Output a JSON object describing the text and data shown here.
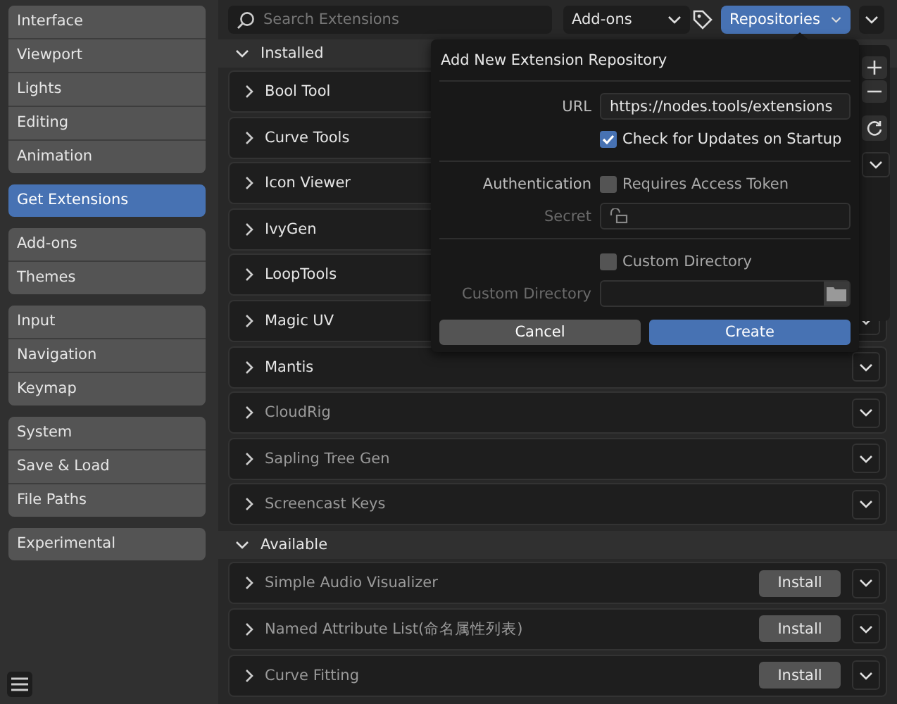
{
  "sidebar": {
    "groups": [
      [
        {
          "label": "Interface",
          "selected": false
        },
        {
          "label": "Viewport",
          "selected": false
        },
        {
          "label": "Lights",
          "selected": false
        },
        {
          "label": "Editing",
          "selected": false
        },
        {
          "label": "Animation",
          "selected": false
        }
      ],
      [
        {
          "label": "Get Extensions",
          "selected": true
        }
      ],
      [
        {
          "label": "Add-ons",
          "selected": false
        },
        {
          "label": "Themes",
          "selected": false
        }
      ],
      [
        {
          "label": "Input",
          "selected": false
        },
        {
          "label": "Navigation",
          "selected": false
        },
        {
          "label": "Keymap",
          "selected": false
        }
      ],
      [
        {
          "label": "System",
          "selected": false
        },
        {
          "label": "Save & Load",
          "selected": false
        },
        {
          "label": "File Paths",
          "selected": false
        }
      ],
      [
        {
          "label": "Experimental",
          "selected": false
        }
      ]
    ]
  },
  "toolbar": {
    "search": {
      "placeholder": "Search Extensions"
    },
    "filter": "Add-ons",
    "repositories": "Repositories"
  },
  "sections": [
    {
      "title": "Installed",
      "expanded": true,
      "items": [
        {
          "name": "Bool Tool",
          "enabled": true
        },
        {
          "name": "Curve Tools",
          "enabled": true
        },
        {
          "name": "Icon Viewer",
          "enabled": true
        },
        {
          "name": "IvyGen",
          "enabled": true
        },
        {
          "name": "LoopTools",
          "enabled": true
        },
        {
          "name": "Magic UV",
          "enabled": true,
          "dropdown": true
        },
        {
          "name": "Mantis",
          "enabled": true,
          "dropdown": true
        },
        {
          "name": "CloudRig",
          "enabled": false,
          "dropdown": true
        },
        {
          "name": "Sapling Tree Gen",
          "enabled": false,
          "dropdown": true
        },
        {
          "name": "Screencast Keys",
          "enabled": false,
          "dropdown": true
        }
      ]
    },
    {
      "title": "Available",
      "expanded": true,
      "items": [
        {
          "name": "Simple Audio Visualizer",
          "enabled": false,
          "install": "Install",
          "dropdown": true
        },
        {
          "name": "Named Attribute List(命名属性列表)",
          "enabled": false,
          "install": "Install",
          "dropdown": true
        },
        {
          "name": "Curve Fitting",
          "enabled": false,
          "install": "Install",
          "dropdown": true
        }
      ]
    }
  ],
  "dialog": {
    "title": "Add New Extension Repository",
    "fields": [
      {
        "kind": "text",
        "label": "URL",
        "value": "https://nodes.tools/extensions",
        "disabled": false
      },
      {
        "kind": "check",
        "label": "Check for Updates on Startup",
        "checked": true
      },
      {
        "kind": "separator"
      },
      {
        "kind": "check",
        "label": "Requires Access Token",
        "caption": "Authentication",
        "checked": false
      },
      {
        "kind": "secret",
        "label": "Secret",
        "disabled": true
      },
      {
        "kind": "separator"
      },
      {
        "kind": "check",
        "label": "Custom Directory",
        "checked": false
      },
      {
        "kind": "directory",
        "label": "Custom Directory",
        "disabled": true
      }
    ],
    "buttons": [
      {
        "label": "Cancel",
        "kind": "secondary"
      },
      {
        "label": "Create",
        "kind": "primary"
      }
    ]
  }
}
